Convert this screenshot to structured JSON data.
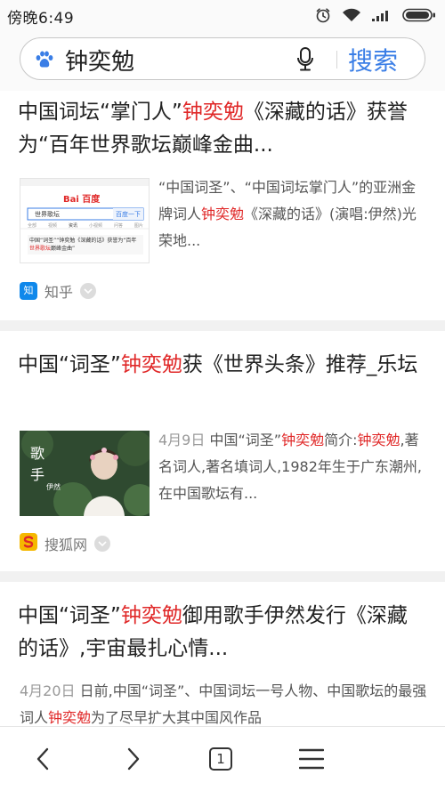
{
  "status_bar": {
    "time": "傍晚6:49",
    "icons": [
      "alarm-icon",
      "wifi-icon",
      "signal-icon",
      "battery-icon"
    ]
  },
  "search": {
    "query": "钟奕勉",
    "placeholder": "",
    "button_label": "搜索",
    "icons": {
      "logo": "baidu-paw-icon",
      "voice": "microphone-icon"
    }
  },
  "results": [
    {
      "title_parts": [
        "中国词坛“掌门人”",
        "钟奕勉",
        "《深藏的话》获誉为“百年世界歌坛巅峰金曲..."
      ],
      "snippet_parts": [
        "“中国词圣”、“中国词坛掌门人”的亚洲金牌词人",
        "钟奕勉",
        "《深藏的话》(演唱:伊然)光荣地..."
      ],
      "thumbnail": {
        "logo_text": "Bai 百度",
        "search_text": "世界歌坛",
        "button_text": "百度一下",
        "tabs": [
          "全部",
          "视频",
          "资讯",
          "小视频",
          "问答",
          "图片"
        ],
        "caption_parts": [
          "中国“词圣”“钟奕勉《深藏的话》获誉为“百年",
          "世界歌坛",
          "巅峰金曲”"
        ]
      },
      "source": "知乎",
      "source_icon": "zhihu-icon",
      "source_icon_text": "知"
    },
    {
      "title_parts": [
        "中国“词圣”",
        "钟奕勉",
        "获《世界头条》推荐_乐坛"
      ],
      "date": "4月9日",
      "snippet_parts": [
        "中国“词圣”",
        "钟奕勉",
        "简介:",
        "钟奕勉",
        ",著名词人,著名填词人,1982年生于广东潮州,在中国歌坛有..."
      ],
      "thumbnail": {
        "vertical_text_1": "歌",
        "vertical_text_2": "手",
        "vertical_text_3": "伊然"
      },
      "source": "搜狐网",
      "source_icon": "sohu-icon"
    },
    {
      "title_parts": [
        "中国“词圣”",
        "钟奕勉",
        "御用歌手伊然发行《深藏的话》,宇宙最扎心情..."
      ],
      "date": "4月20日",
      "snippet_parts": [
        "日前,中国“词圣”、中国词坛一号人物、中国歌坛的最强词人",
        "钟奕勉",
        "为了尽早扩大其中国风作品"
      ]
    }
  ],
  "bottom_nav": {
    "back_icon": "chevron-left-icon",
    "forward_icon": "chevron-right-icon",
    "tab_count": "1",
    "menu_icon": "hamburger-menu-icon"
  },
  "colors": {
    "accent": "#3a7ee6",
    "highlight": "#e02828",
    "separator": "#f1f1f1"
  }
}
